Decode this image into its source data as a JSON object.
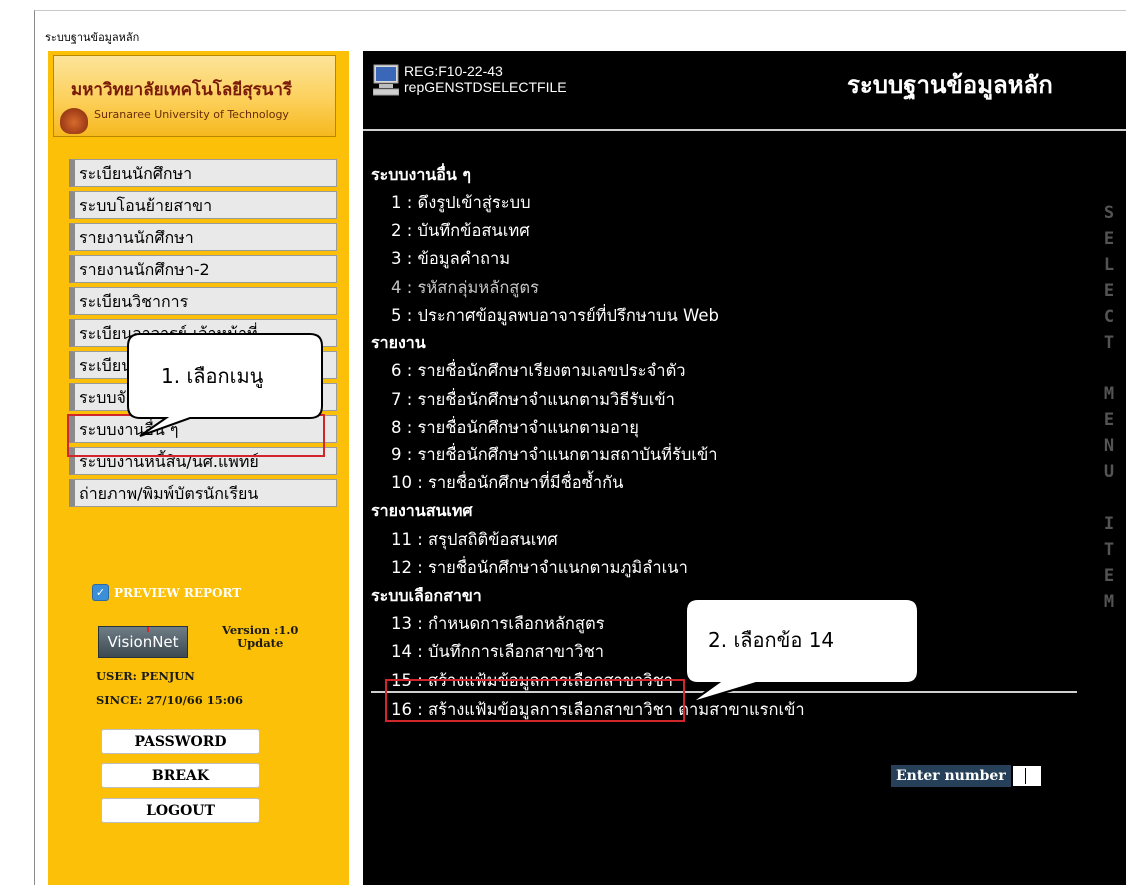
{
  "window": {
    "title": "ระบบฐานข้อมูลหลัก"
  },
  "sidebar": {
    "university_name_th": "มหาวิทยาลัยเทคโนโลยีสุรนารี",
    "university_name_en": "Suranaree University of Technology",
    "menu_items": [
      "ระเบียนนักศึกษา",
      "ระบบโอนย้ายสาขา",
      "รายงานนักศึกษา",
      "รายงานนักศึกษา-2",
      "ระเบียนวิชาการ",
      "ระเบียนอาจารย์-เจ้าหน้าที่",
      "ระเบียนภาพถ่าย",
      "ระบบจัดการข้อมูล",
      "ระบบงานอื่น ๆ",
      "ระบบงานหนี้สิน/นศ.แพทย์",
      "ถ่ายภาพ/พิมพ์บัตรนักเรียน"
    ],
    "preview_report": {
      "label": "PREVIEW REPORT",
      "checked": true
    },
    "vision_logo": "VisionNet",
    "version": {
      "line1": "Version :1.0",
      "line2": "Update"
    },
    "user": "USER: PENJUN",
    "since": "SINCE: 27/10/66 15:06",
    "buttons": {
      "password": "PASSWORD",
      "break": "BREAK",
      "logout": "LOGOUT"
    }
  },
  "main": {
    "reg_code": "REG:F10-22-43",
    "report_code": "repGENSTDSELECTFILE",
    "title": "ระบบฐานข้อมูลหลัก",
    "vertical_label": "SELECT MENU ITEM",
    "sections": {
      "other": "ระบบงานอื่น ๆ",
      "reports": "รายงาน",
      "info_reports": "รายงานสนเทศ",
      "branch": "ระบบเลือกสาขา"
    },
    "items": [
      "1 : ดึงรูปเข้าสู่ระบบ",
      "2 : บันทึกข้อสนเทศ",
      "3 : ข้อมูลคำถาม",
      "4 : รหัสกลุ่มหลักสูตร",
      "5 : ประกาศข้อมูลพบอาจารย์ที่ปรึกษาบน Web",
      "6 : รายชื่อนักศึกษาเรียงตามเลขประจำตัว",
      "7 : รายชื่อนักศึกษาจำแนกตามวิธีรับเข้า",
      "8 : รายชื่อนักศึกษาจำแนกตามอายุ",
      "9 : รายชื่อนักศึกษาจำแนกตามสถาบันที่รับเข้า",
      "10 : รายชื่อนักศึกษาที่มีชื่อซ้ำกัน",
      "11 : สรุปสถิติข้อสนเทศ",
      "12 : รายชื่อนักศึกษาจำแนกตามภูมิลำเนา",
      "13 : กำหนดการเลือกหลักสูตร",
      "14 : บันทึกการเลือกสาขาวิชา",
      "15 : สร้างแฟ้มข้อมูลการเลือกสาขาวิชา",
      "16 : สร้างแฟ้มข้อมูลการเลือกสาขาวิชา  ตามสาขาแรกเข้า"
    ],
    "enter_number_label": "Enter number"
  },
  "annotations": {
    "callout1": "1.  เลือกเมนู",
    "callout2": "2.  เลือกข้อ 14"
  },
  "colors": {
    "sidebar_bg": "#fbc007",
    "main_bg": "#000000",
    "highlight": "#d1272a"
  }
}
